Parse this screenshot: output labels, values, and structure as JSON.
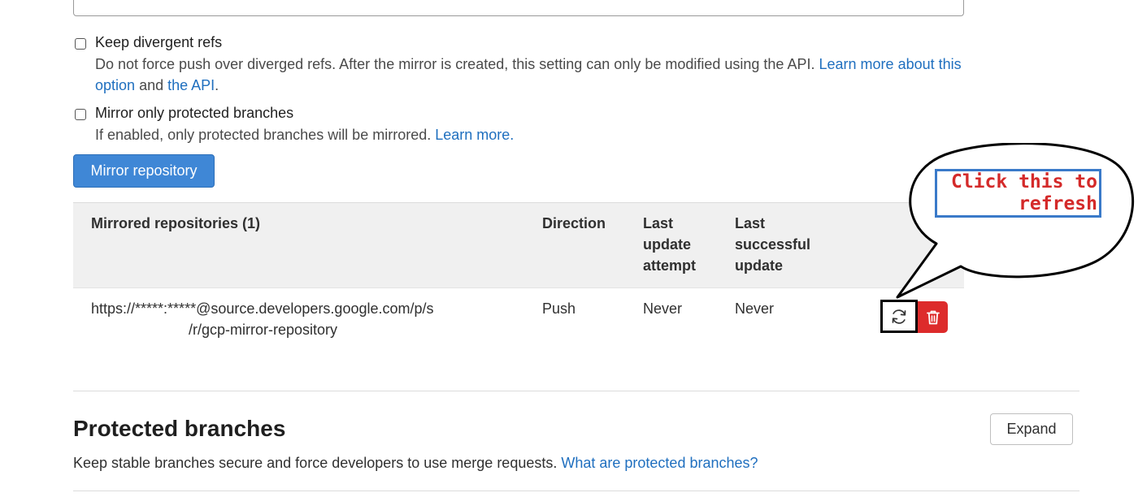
{
  "options": {
    "keep_divergent": {
      "label": "Keep divergent refs",
      "help": "Do not force push over diverged refs. After the mirror is created, this setting can only be modified using the API.",
      "link1_a": "Learn more",
      "link1_b": "about this option",
      "and": "and",
      "link2": "the API",
      "period": "."
    },
    "protected_only": {
      "label": "Mirror only protected branches",
      "help": "If enabled, only protected branches will be mirrored.",
      "link": "Learn more."
    }
  },
  "mirror_button": "Mirror repository",
  "table": {
    "headers": {
      "repo": "Mirrored repositories (1)",
      "direction": "Direction",
      "last_attempt_1": "Last",
      "last_attempt_2": "update",
      "last_attempt_3": "attempt",
      "last_success_1": "Last",
      "last_success_2": "successful",
      "last_success_3": "update"
    },
    "rows": [
      {
        "url_line1": "https://*****:*****@source.developers.google.com/p/s",
        "url_line2": "/r/gcp-mirror-repository",
        "direction": "Push",
        "last_attempt": "Never",
        "last_success": "Never"
      }
    ]
  },
  "callout": {
    "text": "Click this to\nrefresh",
    "color": "#d42a2a",
    "border": "#3a7ac9"
  },
  "protected_branches": {
    "title": "Protected branches",
    "expand_label": "Expand",
    "description": "Keep stable branches secure and force developers to use merge requests.",
    "link": "What are protected branches?"
  },
  "icons": {
    "refresh": "refresh-icon",
    "delete": "trash-icon"
  },
  "colors": {
    "primary": "#3f87d6",
    "danger": "#dd2b2b",
    "link": "#1f6fbf"
  }
}
